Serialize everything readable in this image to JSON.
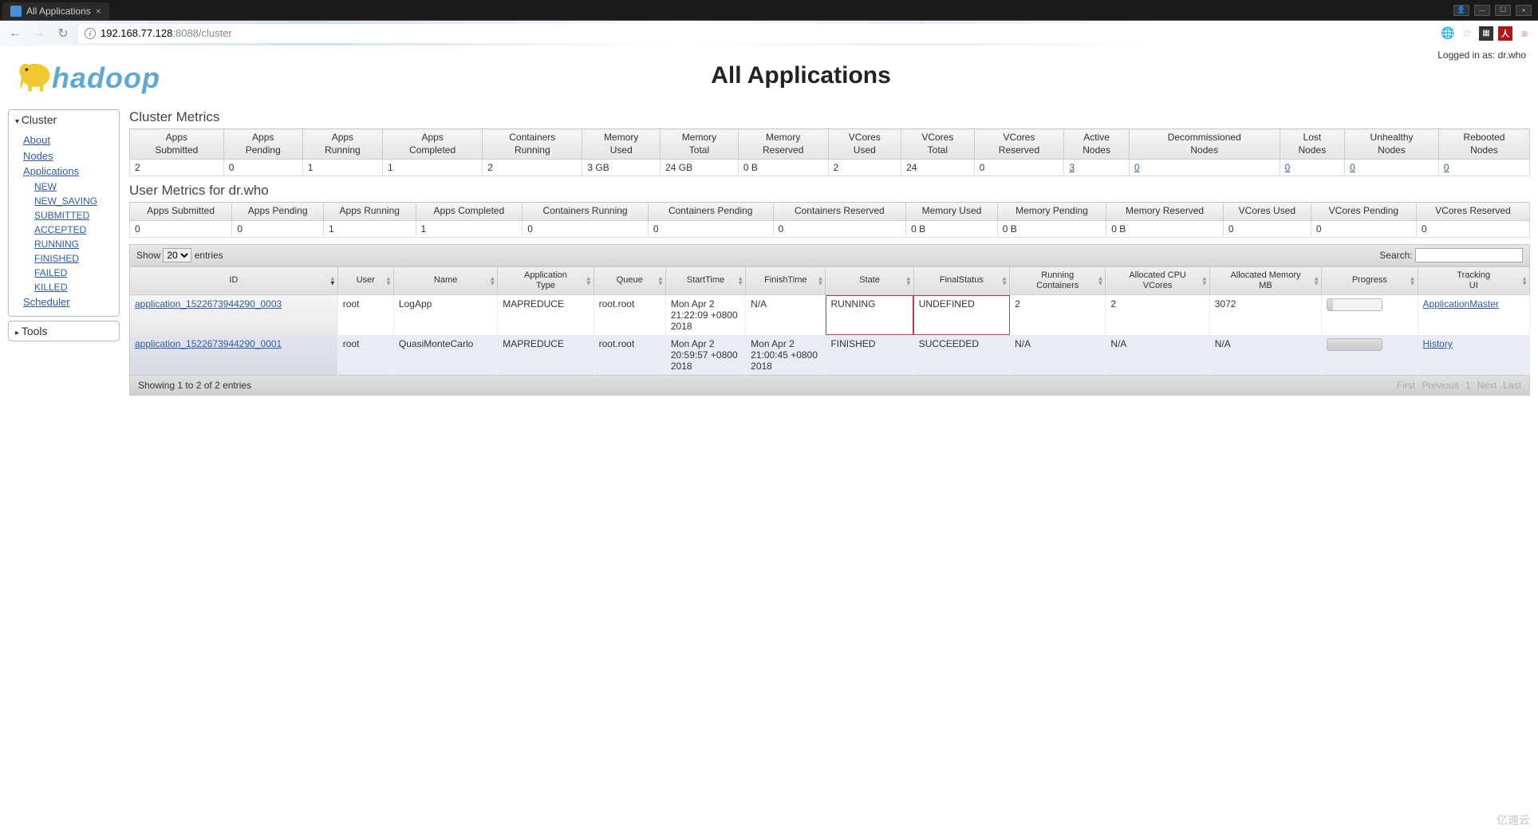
{
  "browser": {
    "tab_title": "All Applications",
    "url_ip": "192.168.77.128",
    "url_path": ":8088/cluster"
  },
  "page": {
    "title": "All Applications",
    "logged_in": "Logged in as: dr.who",
    "logo_text": "hadoop"
  },
  "sidebar": {
    "cluster": {
      "title": "Cluster",
      "about": "About",
      "nodes": "Nodes",
      "applications": "Applications",
      "app_states": [
        "NEW",
        "NEW_SAVING",
        "SUBMITTED",
        "ACCEPTED",
        "RUNNING",
        "FINISHED",
        "FAILED",
        "KILLED"
      ],
      "scheduler": "Scheduler"
    },
    "tools": {
      "title": "Tools"
    }
  },
  "cluster_metrics": {
    "title": "Cluster Metrics",
    "headers": [
      "Apps Submitted",
      "Apps Pending",
      "Apps Running",
      "Apps Completed",
      "Containers Running",
      "Memory Used",
      "Memory Total",
      "Memory Reserved",
      "VCores Used",
      "VCores Total",
      "VCores Reserved",
      "Active Nodes",
      "Decommissioned Nodes",
      "Lost Nodes",
      "Unhealthy Nodes",
      "Rebooted Nodes"
    ],
    "values": [
      "2",
      "0",
      "1",
      "1",
      "2",
      "3 GB",
      "24 GB",
      "0 B",
      "2",
      "24",
      "0",
      "3",
      "0",
      "0",
      "0",
      "0"
    ],
    "linked_cells": [
      11,
      12,
      13,
      14,
      15
    ]
  },
  "user_metrics": {
    "title": "User Metrics for dr.who",
    "headers": [
      "Apps Submitted",
      "Apps Pending",
      "Apps Running",
      "Apps Completed",
      "Containers Running",
      "Containers Pending",
      "Containers Reserved",
      "Memory Used",
      "Memory Pending",
      "Memory Reserved",
      "VCores Used",
      "VCores Pending",
      "VCores Reserved"
    ],
    "values": [
      "0",
      "0",
      "1",
      "1",
      "0",
      "0",
      "0",
      "0 B",
      "0 B",
      "0 B",
      "0",
      "0",
      "0"
    ]
  },
  "datatable": {
    "show_label": "Show",
    "entries_label": "entries",
    "show_value": "20",
    "search_label": "Search:",
    "search_value": "",
    "columns": [
      "ID",
      "User",
      "Name",
      "Application Type",
      "Queue",
      "StartTime",
      "FinishTime",
      "State",
      "FinalStatus",
      "Running Containers",
      "Allocated CPU VCores",
      "Allocated Memory MB",
      "Progress",
      "Tracking UI"
    ],
    "rows": [
      {
        "id": "application_1522673944290_0003",
        "user": "root",
        "name": "LogApp",
        "type": "MAPREDUCE",
        "queue": "root.root",
        "start": "Mon Apr 2 21:22:09 +0800 2018",
        "finish": "N/A",
        "state": "RUNNING",
        "final_status": "UNDEFINED",
        "running_containers": "2",
        "vcores": "2",
        "memory": "3072",
        "progress": 10,
        "tracking": "ApplicationMaster",
        "highlight": true
      },
      {
        "id": "application_1522673944290_0001",
        "user": "root",
        "name": "QuasiMonteCarlo",
        "type": "MAPREDUCE",
        "queue": "root.root",
        "start": "Mon Apr 2 20:59:57 +0800 2018",
        "finish": "Mon Apr 2 21:00:45 +0800 2018",
        "state": "FINISHED",
        "final_status": "SUCCEEDED",
        "running_containers": "N/A",
        "vcores": "N/A",
        "memory": "N/A",
        "progress": 100,
        "tracking": "History",
        "highlight": false
      }
    ],
    "info": "Showing 1 to 2 of 2 entries",
    "pagination": [
      "First",
      "Previous",
      "1",
      "Next",
      "Last"
    ]
  },
  "watermark": "亿速云"
}
